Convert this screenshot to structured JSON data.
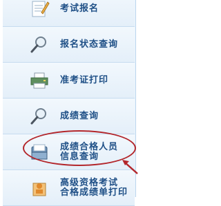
{
  "menu": {
    "items": [
      {
        "label_lines": [
          "考试报名"
        ],
        "icon": "pencil-paper-icon"
      },
      {
        "label_lines": [
          "报名状态查询"
        ],
        "icon": "magnifier-icon"
      },
      {
        "label_lines": [
          "准考证打印"
        ],
        "icon": "printer-icon"
      },
      {
        "label_lines": [
          "成绩查询"
        ],
        "icon": "magnifier-icon"
      },
      {
        "label_lines": [
          "成绩合格人员",
          "信息查询"
        ],
        "icon": "inbox-tray-icon"
      },
      {
        "label_lines": [
          "高级资格考试",
          "合格成绩单打印"
        ],
        "icon": "person-badge-icon"
      }
    ]
  },
  "colors": {
    "label": "#1e4f86",
    "highlight_oval": "#b3262b",
    "arrow": "#b3262b",
    "item_bg": "#eaf4fc",
    "divider": "#c6dcf0"
  }
}
